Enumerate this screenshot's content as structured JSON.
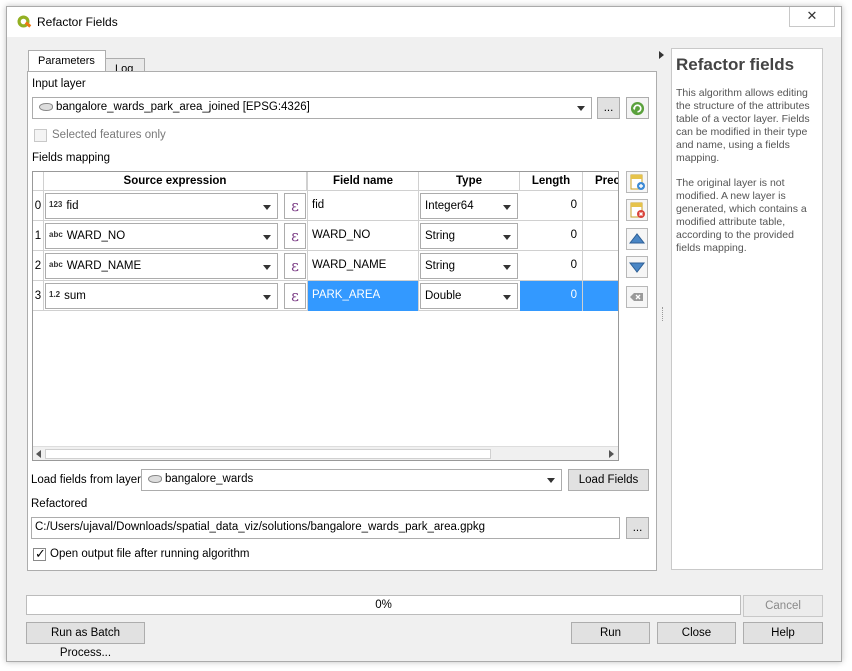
{
  "window": {
    "title": "Refactor Fields",
    "close_label": "✕"
  },
  "tabs": [
    {
      "label": "Parameters"
    },
    {
      "label": "Log"
    }
  ],
  "input_layer": {
    "label": "Input layer",
    "value": "bangalore_wards_park_area_joined [EPSG:4326]",
    "browse_label": "..."
  },
  "selected_only": {
    "label": "Selected features only",
    "checked": false
  },
  "fields_mapping": {
    "label": "Fields mapping",
    "headers": [
      "Source expression",
      "Field name",
      "Type",
      "Length",
      "Prec"
    ],
    "expr_symbol": "ε",
    "rows": [
      {
        "num": "0",
        "badge": "123",
        "source": "fid",
        "field": "fid",
        "type": "Integer64",
        "length": "0"
      },
      {
        "num": "1",
        "badge": "abc",
        "source": "WARD_NO",
        "field": "WARD_NO",
        "type": "String",
        "length": "0"
      },
      {
        "num": "2",
        "badge": "abc",
        "source": "WARD_NAME",
        "field": "WARD_NAME",
        "type": "String",
        "length": "0"
      },
      {
        "num": "3",
        "badge": "1.2",
        "source": "sum",
        "field": "PARK_AREA",
        "type": "Double",
        "length": "0"
      }
    ]
  },
  "load_fields": {
    "label": "Load fields from layer",
    "value": "bangalore_wards",
    "button": "Load Fields"
  },
  "refactored": {
    "label": "Refactored",
    "value": "C:/Users/ujaval/Downloads/spatial_data_viz/solutions/bangalore_wards_park_area.gpkg",
    "browse_label": "..."
  },
  "open_output": {
    "label": "Open output file after running algorithm",
    "checked": true
  },
  "help_panel": {
    "title": "Refactor fields",
    "para1": "This algorithm allows editing the structure of the attributes table of a vector layer. Fields can be modified in their type and name, using a fields mapping.",
    "para2": "The original layer is not modified. A new layer is generated, which contains a modified attribute table, according to the provided fields mapping."
  },
  "progress": {
    "text": "0%",
    "value": 0
  },
  "buttons": {
    "cancel": "Cancel",
    "batch": "Run as Batch Process...",
    "run": "Run",
    "close": "Close",
    "help": "Help"
  }
}
